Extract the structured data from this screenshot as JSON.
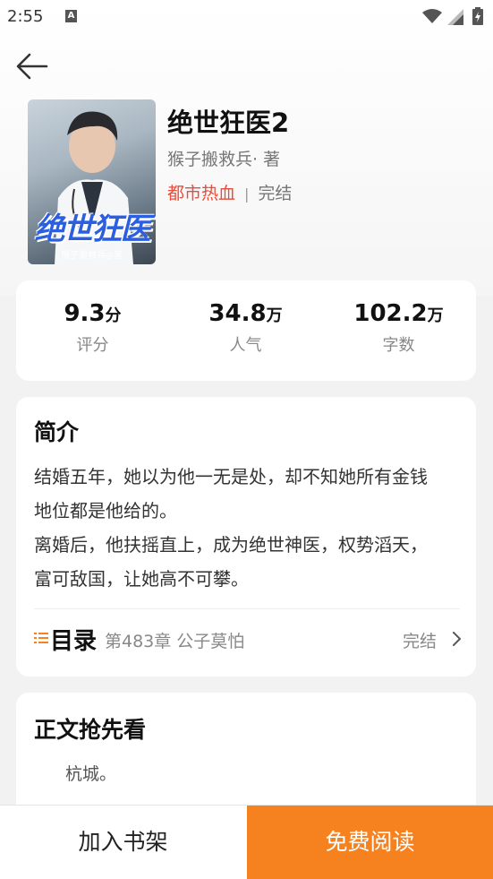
{
  "status_bar": {
    "time": "2:55",
    "notification_icon": "A",
    "icons": [
      "wifi-icon",
      "signal-icon",
      "battery-charging-icon"
    ]
  },
  "header": {
    "back_icon": "arrow-left-icon"
  },
  "book": {
    "cover_title": "绝世狂医",
    "cover_author": "猴子搬救兵◎著",
    "title": "绝世狂医2",
    "author": "猴子搬救兵· 著",
    "genre": "都市热血",
    "separator": "|",
    "status": "完结"
  },
  "stats": [
    {
      "value": "9.3",
      "unit": "分",
      "label": "评分"
    },
    {
      "value": "34.8",
      "unit": "万",
      "label": "人气"
    },
    {
      "value": "102.2",
      "unit": "万",
      "label": "字数"
    }
  ],
  "intro": {
    "title": "简介",
    "lines": [
      "结婚五年，她以为他一无是处，却不知她所有金钱",
      "地位都是他给的。",
      "离婚后，他扶摇直上，成为绝世神医，权势滔天，",
      "富可敌国，让她高不可攀。"
    ]
  },
  "catalog": {
    "label": "目录",
    "latest_chapter": "第483章 公子莫怕",
    "status": "完结"
  },
  "preview": {
    "title": "正文抢先看",
    "text": "杭城。"
  },
  "bottom": {
    "add_shelf": "加入书架",
    "read_free": "免费阅读"
  },
  "colors": {
    "accent": "#f5821f",
    "genre": "#e74c3c",
    "cover_title": "#2b5fe0"
  }
}
